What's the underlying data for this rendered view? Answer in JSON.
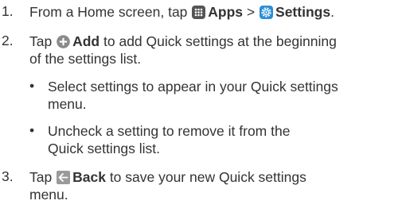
{
  "steps": [
    {
      "number": "1.",
      "prefix": "From a Home screen, tap",
      "apps_label": "Apps",
      "separator": ">",
      "settings_label": "Settings",
      "suffix": ".",
      "apps_icon": "apps-grid-icon",
      "settings_icon": "settings-gear-icon"
    },
    {
      "number": "2.",
      "prefix": "Tap",
      "add_label": "Add",
      "line1_rest": "to add Quick settings at the beginning",
      "line2": "of the settings list.",
      "add_icon": "add-circle-icon"
    },
    {
      "number": "3.",
      "prefix": "Tap",
      "back_label": "Back",
      "line1_rest": "to save your new Quick settings",
      "line2": "menu.",
      "back_icon": "back-arrow-icon"
    }
  ],
  "bullets": [
    {
      "line1": "Select settings to appear in your Quick settings",
      "line2": "menu."
    },
    {
      "line1": "Uncheck a setting to remove it from the",
      "line2": "Quick settings list."
    }
  ],
  "colors": {
    "text": "#333333",
    "apps_icon_bg": "#555555",
    "settings_icon_bg": "#2a8fd6",
    "add_icon_bg": "#8a8a8a",
    "back_icon_bg": "#9a9a9a"
  }
}
